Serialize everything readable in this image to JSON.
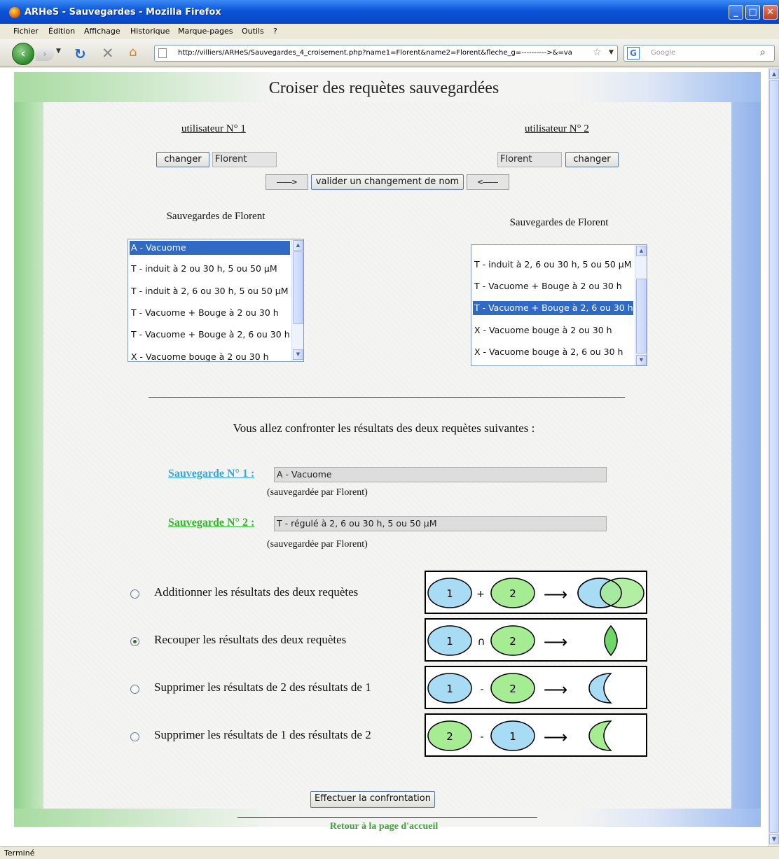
{
  "window": {
    "title": "ARHeS - Sauvegardes - Mozilla Firefox",
    "minimize": "_",
    "maximize": "□",
    "close": "✕"
  },
  "menu": [
    "Fichier",
    "Édition",
    "Affichage",
    "Historique",
    "Marque-pages",
    "Outils",
    "?"
  ],
  "nav": {
    "url": "http://villiers/ARHeS/Sauvegardes_4_croisement.php?name1=Florent&name2=Florent&fleche_g=---------->&=va",
    "search_placeholder": "Google",
    "search_engine_letter": "G"
  },
  "page": {
    "title": "Croiser des requètes sauvegardées",
    "user1_label": "utilisateur N° 1",
    "user2_label": "utilisateur N° 2",
    "change_label": "changer",
    "user1_name": "Florent",
    "user2_name": "Florent",
    "arrow_right": "———>",
    "arrow_left": "<———",
    "validate_label": "valider un changement de nom",
    "list1_title": "Sauvegardes de Florent",
    "list2_title": "Sauvegardes de Florent",
    "list1_items": [
      "A - Vacuome",
      "T - induit à 2 ou 30 h, 5 ou 50 µM",
      "T - induit à 2, 6 ou 30 h, 5 ou 50 µM",
      "T - Vacuome + Bouge à 2 ou 30 h",
      "T - Vacuome + Bouge à 2, 6 ou 30 h",
      "X - Vacuome bouge à 2 ou 30 h"
    ],
    "list1_selected": "A - Vacuome",
    "list2_items": [
      "T - induit à 2, 6 ou 30 h, 5 ou 50 µM",
      "T - Vacuome + Bouge à 2 ou 30 h",
      "T - Vacuome + Bouge à 2, 6 ou 30 h",
      "X - Vacuome bouge à 2 ou 30 h",
      "X - Vacuome bouge à 2, 6 ou 30 h"
    ],
    "list2_selected": "T - Vacuome + Bouge à 2, 6 ou 30 h",
    "confront_title": "Vous allez confronter les résultats des deux requètes suivantes :",
    "save1_label": "Sauvegarde N° 1 :",
    "save1_value": "A - Vacuome",
    "save1_by": "(sauvegardée par Florent)",
    "save2_label": "Sauvegarde N° 2 :",
    "save2_value": "T - régulé à 2, 6 ou 30 h, 5 ou 50 µM",
    "save2_by": "(sauvegardée par Florent)",
    "operations": [
      {
        "label": "Additionner les résultats des deux requètes",
        "first": "1",
        "op": "+",
        "second": "2",
        "checked": false
      },
      {
        "label": "Recouper les résultats des deux requètes",
        "first": "1",
        "op": "∩",
        "second": "2",
        "checked": true
      },
      {
        "label": "Supprimer les résultats de 2 des résultats de 1",
        "first": "1",
        "op": "-",
        "second": "2",
        "checked": false
      },
      {
        "label": "Supprimer les résultats de 1 des résultats de 2",
        "first": "2",
        "op": "-",
        "second": "1",
        "checked": false
      }
    ],
    "arrow": "⟶",
    "submit_label": "Effectuer la confrontation",
    "home_link": "Retour à la page d'accueil"
  },
  "colors": {
    "blue_set": "#a8dcf4",
    "green_set": "#a6ec92",
    "save1": "#3aa6d8",
    "save2": "#33b52d",
    "selection": "#316ac5"
  },
  "status": "Terminé"
}
